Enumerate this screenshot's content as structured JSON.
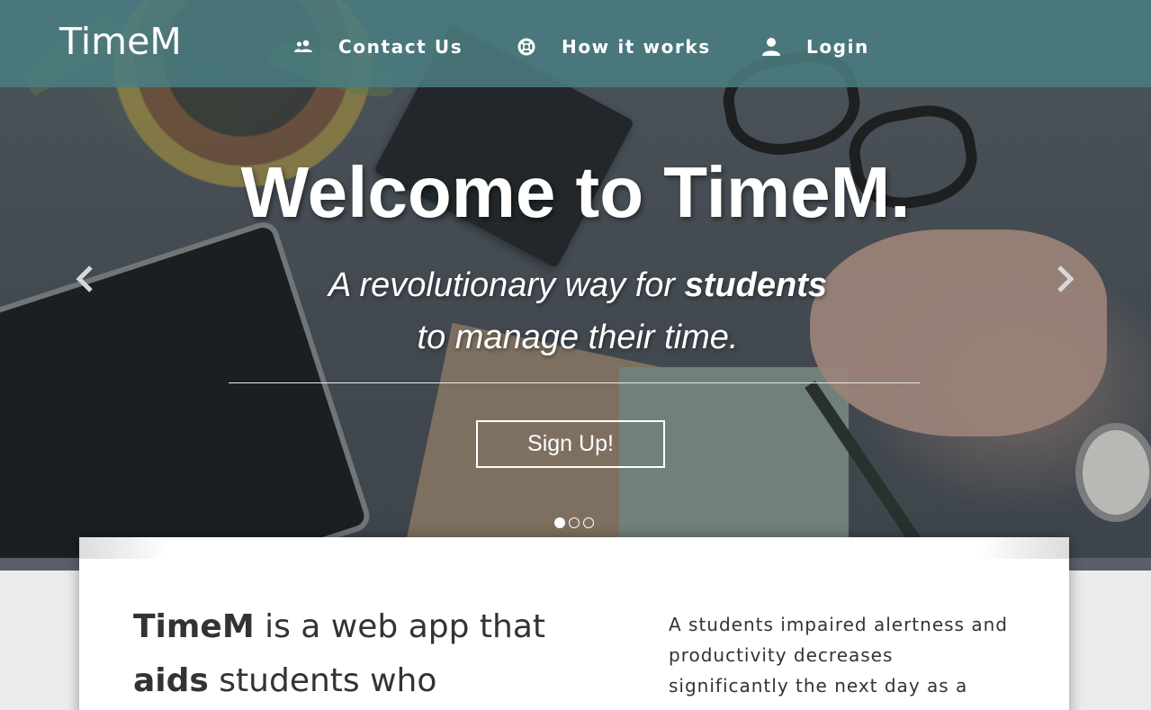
{
  "nav": {
    "brand": "TimeM",
    "items": [
      {
        "label": "Contact Us",
        "icon": "people-icon"
      },
      {
        "label": "How it works",
        "icon": "lifebuoy-icon"
      },
      {
        "label": "Login",
        "icon": "user-icon"
      }
    ]
  },
  "hero": {
    "title": "Welcome to TimeM.",
    "subtitle_pre": "A revolutionary way for ",
    "subtitle_bold": "students",
    "subtitle_post": "to manage their time.",
    "cta_label": "Sign Up!",
    "prev_icon": "chevron-left-icon",
    "next_icon": "chevron-right-icon",
    "slides": 3,
    "active_slide": 1
  },
  "intro": {
    "brand_bold": "TimeM",
    "lead_mid": " is a web app that ",
    "aids_bold": "aids",
    "lead_end": " students who",
    "paragraph": "A students impaired alertness and productivity decreases significantly the next day as a"
  },
  "colors": {
    "navbar": "#4a7c80",
    "text_dark": "#333333",
    "white": "#ffffff"
  }
}
